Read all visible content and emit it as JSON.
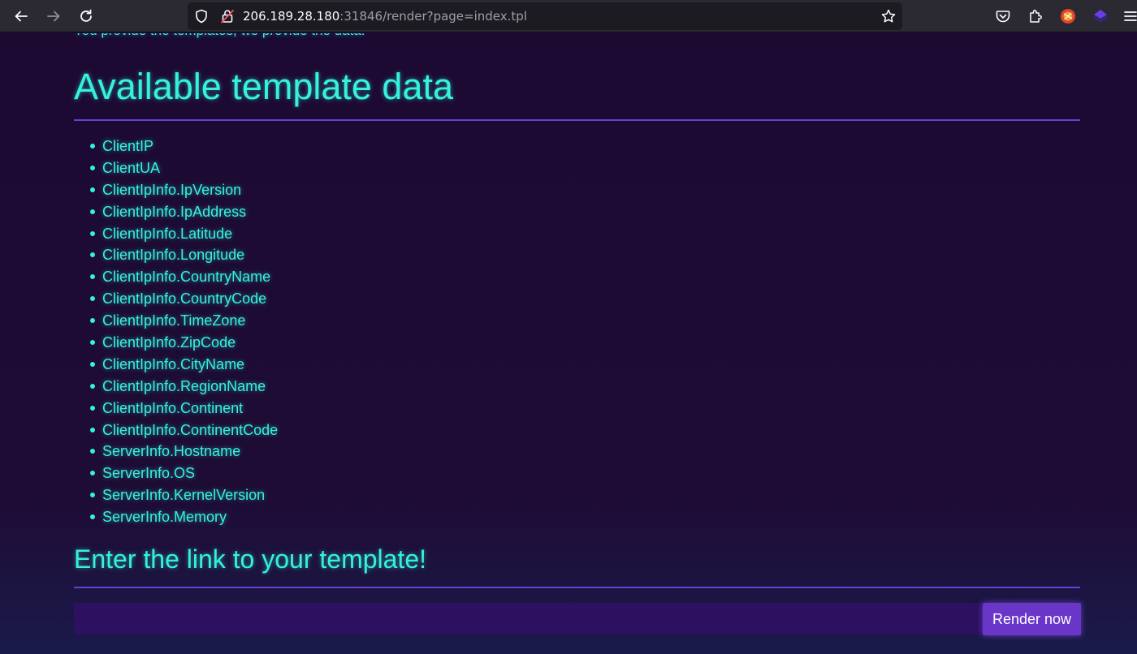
{
  "browser": {
    "url_host": "206.189.28.180",
    "url_rest": ":31846/render?page=index.tpl",
    "icons": [
      "back-icon",
      "forward-icon",
      "reload-icon",
      "shield-icon",
      "insecure-lock-icon",
      "bookmark-star-icon",
      "pocket-icon",
      "extensions-icon",
      "profile-avatar-icon",
      "extension-icon",
      "menu-icon"
    ]
  },
  "page": {
    "intro": "You provide the templates, we provide the data!",
    "heading_available": "Available template data",
    "data_items": [
      "ClientIP",
      "ClientUA",
      "ClientIpInfo.IpVersion",
      "ClientIpInfo.IpAddress",
      "ClientIpInfo.Latitude",
      "ClientIpInfo.Longitude",
      "ClientIpInfo.CountryName",
      "ClientIpInfo.CountryCode",
      "ClientIpInfo.TimeZone",
      "ClientIpInfo.ZipCode",
      "ClientIpInfo.CityName",
      "ClientIpInfo.RegionName",
      "ClientIpInfo.Continent",
      "ClientIpInfo.ContinentCode",
      "ServerInfo.Hostname",
      "ServerInfo.OS",
      "ServerInfo.KernelVersion",
      "ServerInfo.Memory"
    ],
    "heading_enter": "Enter the link to your template!",
    "input_value": "",
    "button_label": "Render now"
  },
  "colors": {
    "accent": "#34f2dc",
    "background": "#1e0c35",
    "rule": "#6b3fd0",
    "button": "#6a35c9",
    "input": "#2d1060"
  }
}
